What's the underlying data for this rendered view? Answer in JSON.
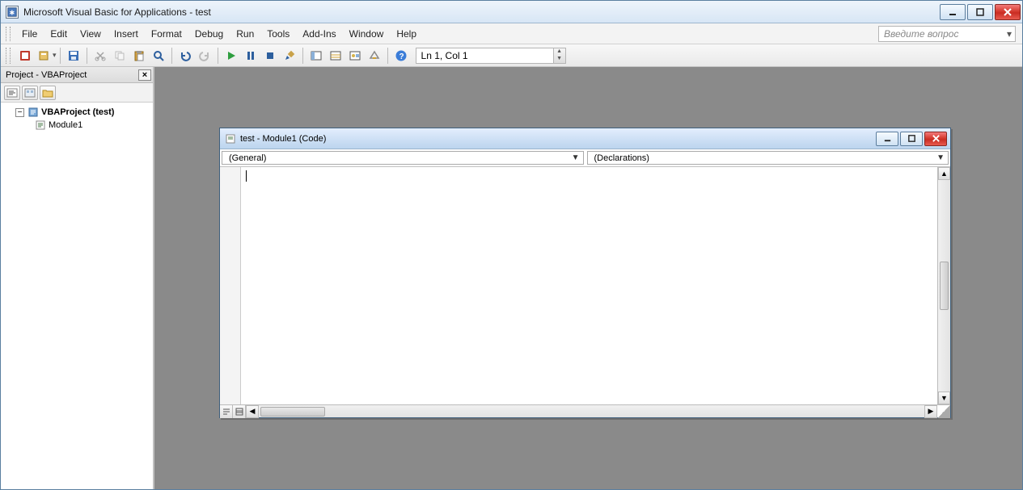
{
  "window": {
    "title": "Microsoft Visual Basic for Applications - test"
  },
  "menubar": {
    "items": [
      "File",
      "Edit",
      "View",
      "Insert",
      "Format",
      "Debug",
      "Run",
      "Tools",
      "Add-Ins",
      "Window",
      "Help"
    ],
    "help_placeholder": "Введите вопрос"
  },
  "toolbar": {
    "status_text": "Ln 1, Col 1"
  },
  "project_panel": {
    "title": "Project - VBAProject",
    "root": "VBAProject (test)",
    "module": "Module1"
  },
  "code_window": {
    "title": "test - Module1 (Code)",
    "object_dropdown": "(General)",
    "proc_dropdown": "(Declarations)"
  }
}
